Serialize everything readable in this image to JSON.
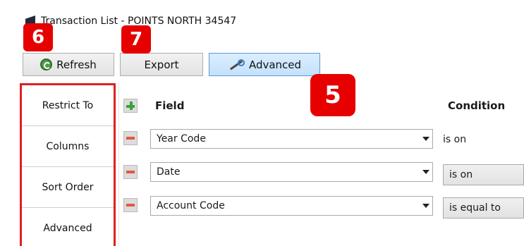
{
  "window": {
    "title": "Transaction List - POINTS NORTH 34547"
  },
  "toolbar": {
    "refresh_label": "Refresh",
    "export_label": "Export",
    "advanced_label": "Advanced"
  },
  "callouts": [
    "6",
    "7",
    "5"
  ],
  "side_tabs": [
    "Restrict To",
    "Columns",
    "Sort Order",
    "Advanced"
  ],
  "grid": {
    "headers": {
      "field": "Field",
      "condition": "Condition"
    },
    "rows": [
      {
        "field": "Year Code",
        "condition": "is on"
      },
      {
        "field": "Date",
        "condition": "is on"
      },
      {
        "field": "Account Code",
        "condition": "is equal to"
      }
    ]
  },
  "colors": {
    "callout": "#e60000",
    "highlight_border": "#e02020",
    "active_button": "#c4e1fb"
  }
}
